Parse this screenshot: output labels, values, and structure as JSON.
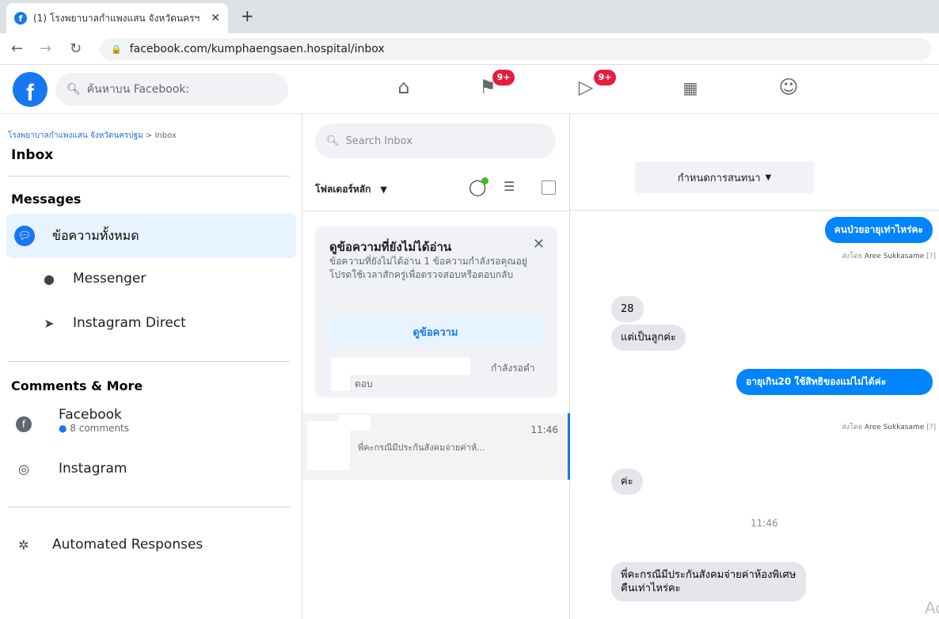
{
  "browser": {
    "tab_title": "(1) โรงพยาบาลกำแพงแสน จังหวัดนครฯ",
    "tab_close": "✕",
    "new_tab": "+",
    "url": "facebook.com/kumphaengsaen.hospital/inbox"
  },
  "topbar": {
    "logo": "f",
    "search_placeholder": "ค้นหาบน Facebook:",
    "nav": [
      {
        "icon": "home-icon",
        "glyph": "⌂"
      },
      {
        "icon": "flag-icon",
        "glyph": "⚑",
        "badge": "9+"
      },
      {
        "icon": "video-icon",
        "glyph": "▷",
        "badge": "9+"
      },
      {
        "icon": "marketplace-icon",
        "glyph": "🏪"
      },
      {
        "icon": "groups-icon",
        "glyph": "☺"
      }
    ]
  },
  "sidebar": {
    "breadcrumb_page": "โรงพยาบาลกำแพงแสน จังหวัดนครปฐม",
    "breadcrumb_sep": " > ",
    "breadcrumb_current": "Inbox",
    "title": "Inbox",
    "messages_heading": "Messages",
    "all_messages": "ข้อความทั้งหมด",
    "messenger": "Messenger",
    "instagram_direct": "Instagram Direct",
    "comments_heading": "Comments & More",
    "facebook": "Facebook",
    "facebook_comments": "8 comments",
    "instagram": "Instagram",
    "automated": "Automated Responses"
  },
  "threads": {
    "search_placeholder": "Search Inbox",
    "folder": "โฟลเดอร์หลัก",
    "unread_card": {
      "title": "ดูข้อความที่ยังไม่ได้อ่าน",
      "body": "ข้อความที่ยังไม่ได้อ่าน 1 ข้อความกำลังรอคุณอยู่ โปรดใช้เวลาสักครู่เพื่อตรวจสอบหรือตอบกลับ",
      "button": "ดูข้อความ",
      "waiting": "กำลังรอคำ",
      "reply": "ตอบ"
    },
    "row": {
      "time": "11:46",
      "preview": "พี่คะกรณีมีประกันสังคมจ่ายค่าห้..."
    }
  },
  "chat": {
    "assign": "กำหนดการสนทนา",
    "messages": [
      {
        "dir": "out",
        "text": "คนป่วยอายุเท่าไหร่คะ"
      },
      {
        "dir": "in",
        "text": "28"
      },
      {
        "dir": "in",
        "text": "แต่เป็นลูกค่ะ"
      },
      {
        "dir": "out",
        "text": "อายุเกิน20 ใช้สิทธิของแม่ไม่ได้ค่ะ"
      },
      {
        "dir": "in",
        "text": "ค่ะ"
      },
      {
        "dir": "in",
        "text": "พี่คะกรณีมีประกันสังคมจ่ายค่าห้องพิเศษคืนเท่าไหร่คะ"
      }
    ],
    "sent_by_prefix": "ส่งโดย",
    "sent_by_name": "Aree Sukkasame",
    "sent_by_suffix": "[?]",
    "time": "11:46",
    "corner_text": "Ac"
  }
}
